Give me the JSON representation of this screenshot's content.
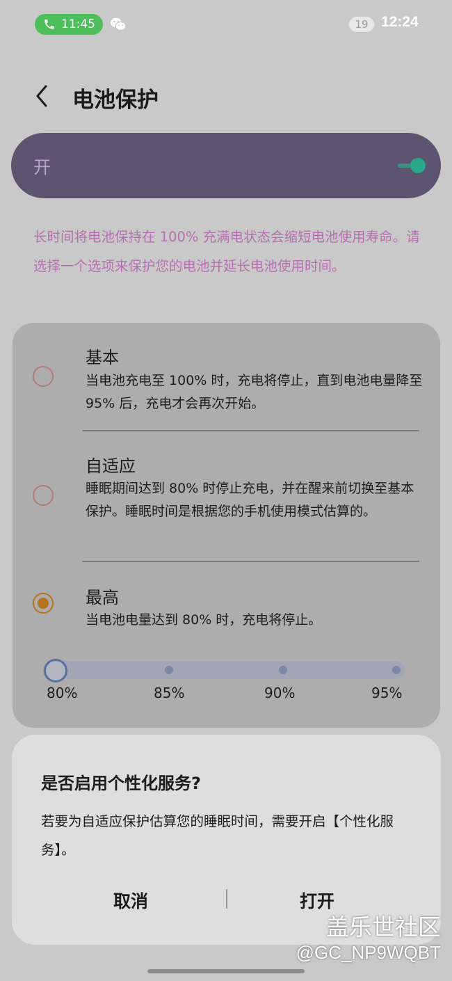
{
  "status_bar": {
    "call_time": "11:45",
    "notification_count": "19",
    "clock": "12:24"
  },
  "header": {
    "title": "电池保护"
  },
  "master_switch": {
    "label": "开",
    "state": "on"
  },
  "description": "长时间将电池保持在 100% 充满电状态会缩短电池使用寿命。请选择一个选项来保护您的电池并延长电池使用时间。",
  "options": [
    {
      "title": "基本",
      "desc": "当电池充电至 100% 时，充电将停止，直到电池电量降至 95% 后，充电才会再次开始。",
      "selected": false
    },
    {
      "title": "自适应",
      "desc": "睡眠期间达到 80% 时停止充电，并在醒来前切换至基本保护。睡眠时间是根据您的手机使用模式估算的。",
      "selected": false
    },
    {
      "title": "最高",
      "desc": "当电池电量达到 80% 时，充电将停止。",
      "selected": true
    }
  ],
  "slider": {
    "ticks": [
      "80%",
      "85%",
      "90%",
      "95%"
    ],
    "selected": "80%"
  },
  "dialog": {
    "title": "是否启用个性化服务?",
    "body": "若要为自适应保护估算您的睡眠时间，需要开启【个性化服务】。",
    "cancel": "取消",
    "confirm": "打开"
  },
  "watermark": {
    "line1": "盖乐世社区",
    "line2": "@GC_NP9WQBT"
  },
  "colors": {
    "accent_green": "#2aa88a",
    "description_text": "#b56fb0",
    "radio_selected": "#b8731e",
    "toggle_row_bg": "#5d5570"
  }
}
